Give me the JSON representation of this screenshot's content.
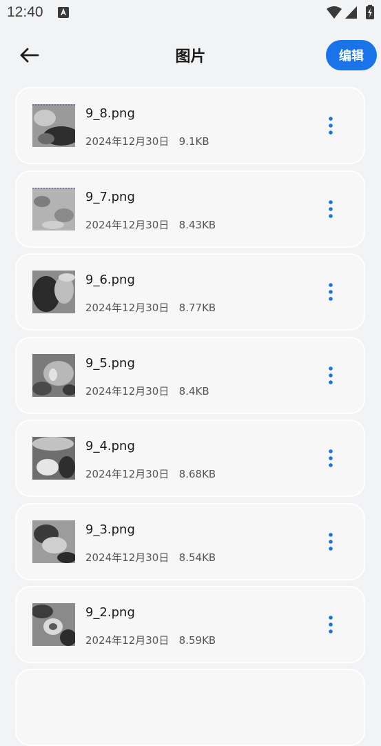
{
  "status_bar": {
    "time": "12:40",
    "app_icon": "a-icon",
    "icons": [
      "wifi-icon",
      "signal-icon",
      "battery-charging-icon"
    ]
  },
  "header": {
    "back_icon": "arrow-left-icon",
    "title": "图片",
    "edit_label": "编辑"
  },
  "colors": {
    "accent": "#1a73e8",
    "background": "#f2f3f5",
    "card": "#f7f7f7"
  },
  "files": [
    {
      "name": "9_8.png",
      "date": "2024年12月30日",
      "size": "9.1KB"
    },
    {
      "name": "9_7.png",
      "date": "2024年12月30日",
      "size": "8.43KB"
    },
    {
      "name": "9_6.png",
      "date": "2024年12月30日",
      "size": "8.77KB"
    },
    {
      "name": "9_5.png",
      "date": "2024年12月30日",
      "size": "8.4KB"
    },
    {
      "name": "9_4.png",
      "date": "2024年12月30日",
      "size": "8.68KB"
    },
    {
      "name": "9_3.png",
      "date": "2024年12月30日",
      "size": "8.54KB"
    },
    {
      "name": "9_2.png",
      "date": "2024年12月30日",
      "size": "8.59KB"
    }
  ],
  "more_icon": "more-vertical-icon"
}
